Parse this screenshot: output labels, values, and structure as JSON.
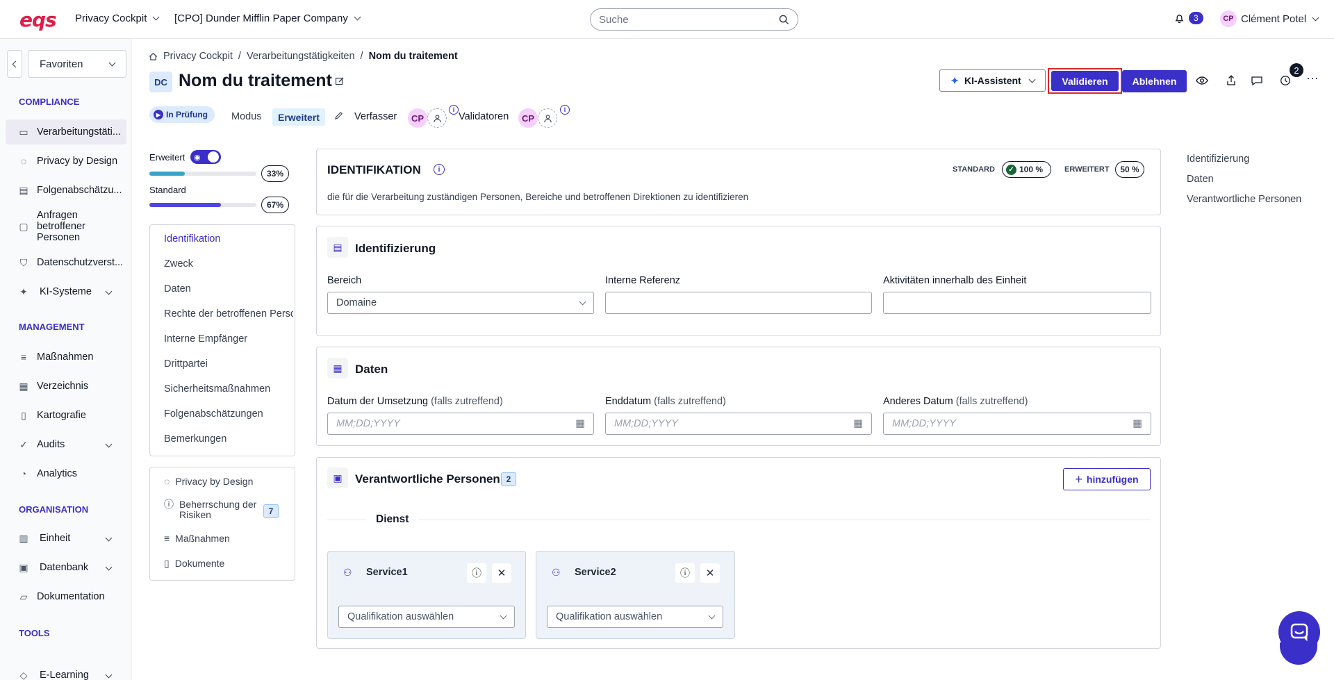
{
  "topbar": {
    "logo": "eqs",
    "app": "Privacy Cockpit",
    "company": "[CPO] Dunder Mifflin Paper Company",
    "search_placeholder": "Suche",
    "notif_count": "3",
    "user_initials": "CP",
    "user_name": "Clément Potel"
  },
  "sidebar": {
    "favorites": "Favoriten",
    "sections": {
      "compliance": "COMPLIANCE",
      "management": "MANAGEMENT",
      "organisation": "ORGANISATION",
      "tools": "TOOLS"
    },
    "items": {
      "verarbeitung": "Verarbeitungstäti...",
      "privacy": "Privacy by Design",
      "folgen": "Folgenabschätzu...",
      "anfragen": "Anfragen betroffener Personen",
      "datenschutz": "Datenschutzverst...",
      "ki": "KI-Systeme",
      "massnahmen": "Maßnahmen",
      "verzeichnis": "Verzeichnis",
      "kartografie": "Kartografie",
      "audits": "Audits",
      "analytics": "Analytics",
      "einheit": "Einheit",
      "datenbank": "Datenbank",
      "dokumentation": "Dokumentation",
      "elearning": "E-Learning"
    }
  },
  "breadcrumb": {
    "c1": "Privacy Cockpit",
    "c2": "Verarbeitungstätigkeiten",
    "c3": "Nom du traitement",
    "sep": "/"
  },
  "header": {
    "badge": "DC",
    "title": "Nom du traitement",
    "ki_button": "KI-Assistent",
    "validate_button": "Validieren",
    "reject_button": "Ablehnen",
    "history_count": "2"
  },
  "status": {
    "state": "In Prüfung",
    "mode_label": "Modus",
    "mode_value": "Erweitert",
    "author_label": "Verfasser",
    "validators_label": "Validatoren",
    "initials": "CP"
  },
  "progress": {
    "extended_label": "Erweitert",
    "extended_value": 33,
    "extended_text": "33%",
    "standard_label": "Standard",
    "standard_value": 67,
    "standard_text": "67%"
  },
  "toc": [
    "Identifikation",
    "Zweck",
    "Daten",
    "Rechte der betroffenen Personen",
    "Interne Empfänger",
    "Drittpartei",
    "Sicherheitsmaßnahmen",
    "Folgenabschätzungen",
    "Bemerkungen"
  ],
  "toc2": {
    "i1": "Privacy by Design",
    "i2": "Beherrschung der Risiken",
    "i2_count": "7",
    "i3": "Maßnahmen",
    "i4": "Dokumente"
  },
  "ident_card": {
    "title": "IDENTIFIKATION",
    "standard_label": "STANDARD",
    "standard_value": "100 %",
    "extended_label": "ERWEITERT",
    "extended_value": "50 %",
    "description": "die für die Verarbeitung zuständigen Personen, Bereiche und betroffenen Direktionen zu identifizieren"
  },
  "identifizierung": {
    "title": "Identifizierung",
    "bereich_label": "Bereich",
    "bereich_value": "Domaine",
    "ref_label": "Interne Referenz",
    "akt_label": "Aktivitäten innerhalb des Einheit"
  },
  "daten": {
    "title": "Daten",
    "d1_label": "Datum der Umsetzung",
    "d2_label": "Enddatum",
    "d3_label": "Anderes Datum",
    "optional": "(falls zutreffend)",
    "placeholder": "MM;DD;YYYY"
  },
  "personen": {
    "title": "Verantwortliche Personen",
    "count": "2",
    "add_button": "hinzufügen",
    "group": "Dienst",
    "s1": "Service1",
    "s2": "Service2",
    "select_placeholder": "Qualifikation auswählen"
  },
  "right_nav": {
    "n1": "Identifizierung",
    "n2": "Daten",
    "n3": "Verantwortliche Personen"
  }
}
